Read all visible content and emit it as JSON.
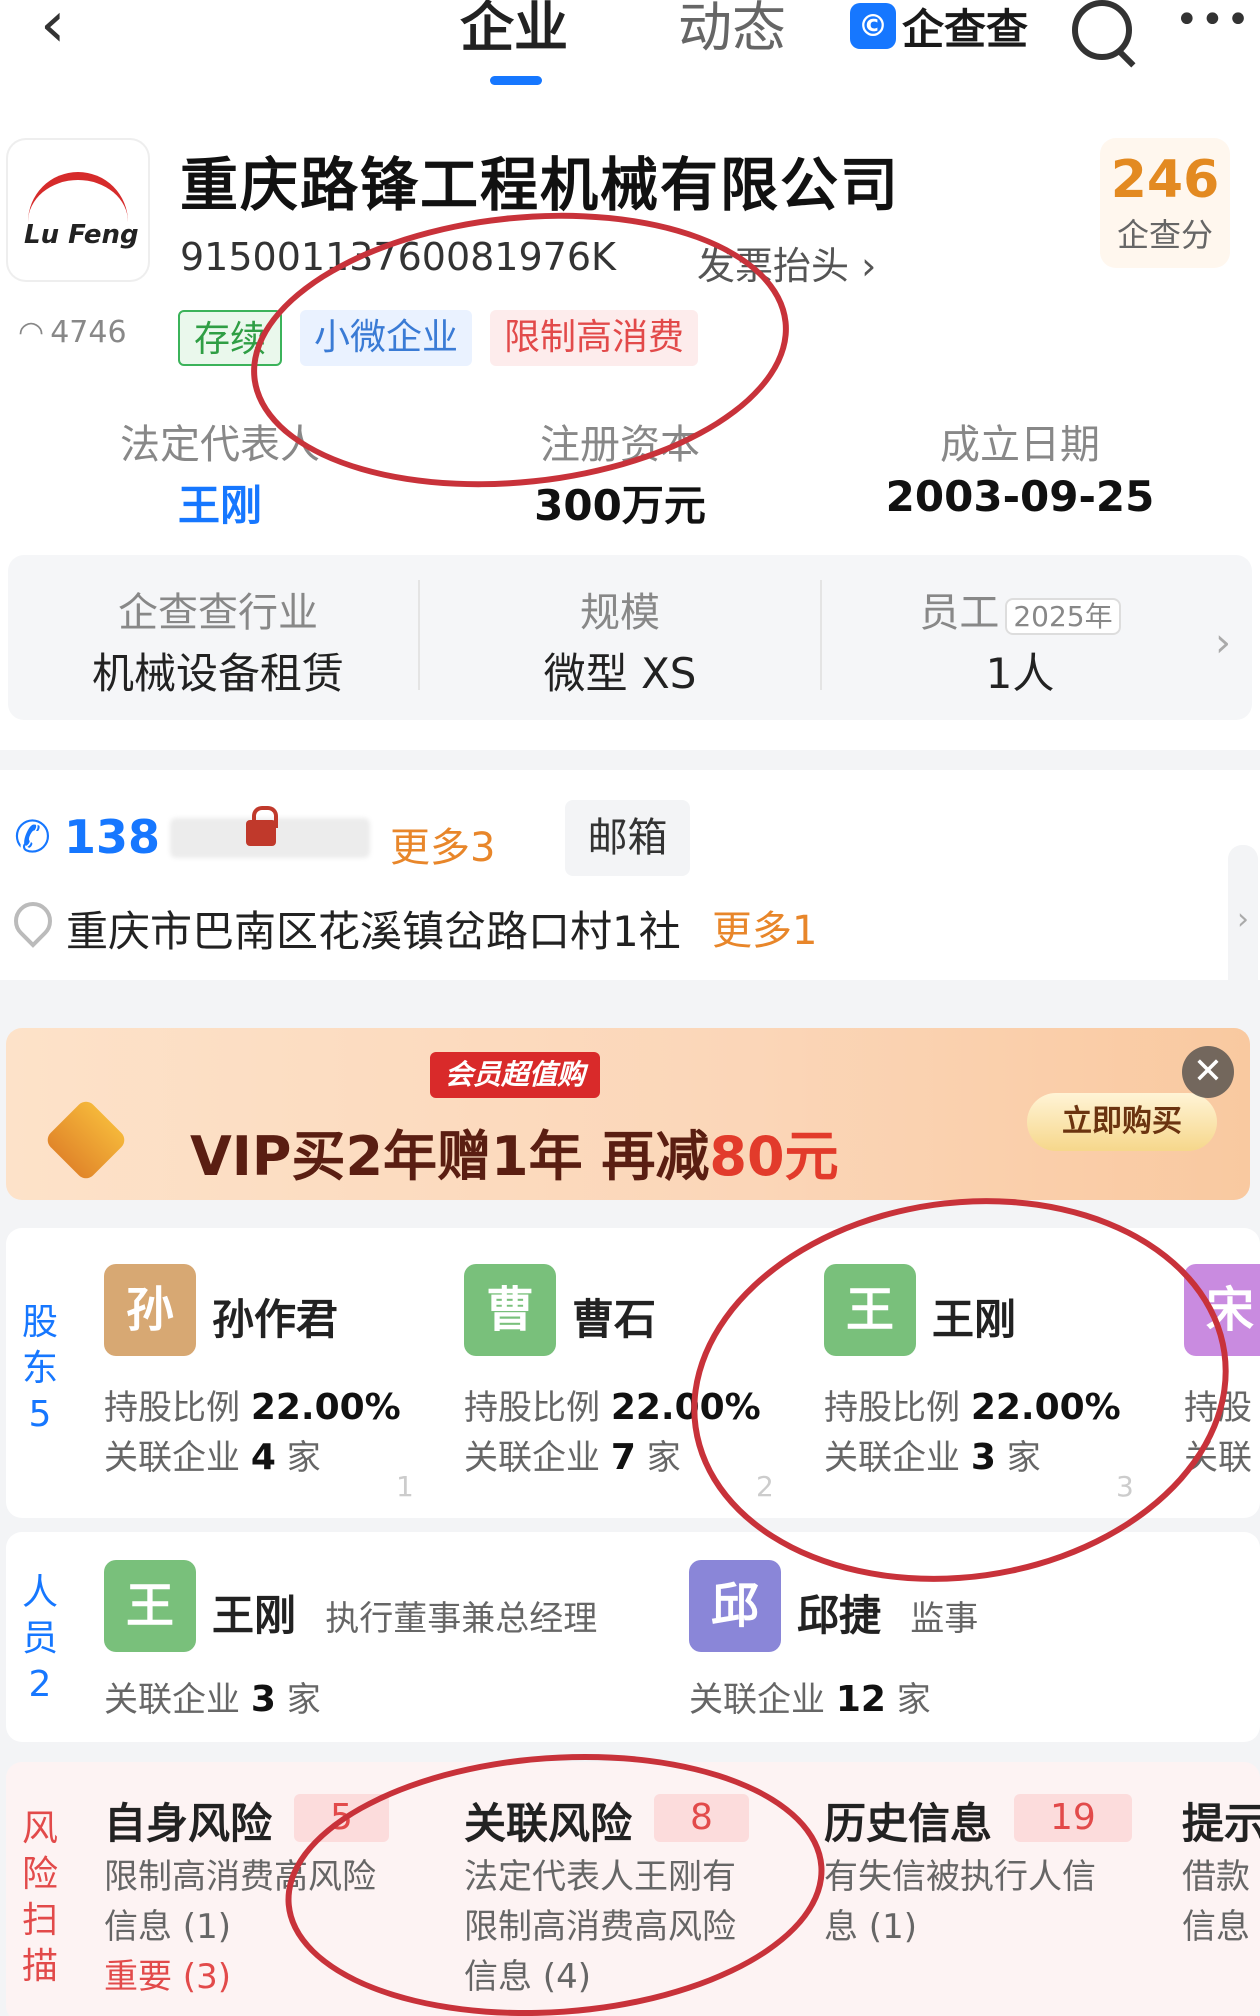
{
  "nav": {
    "tab_company": "企业",
    "tab_news": "动态",
    "brand": "企查查",
    "brand_logo": "©"
  },
  "company": {
    "logo_text": "Lu Feng",
    "name": "重庆路锋工程机械有限公司",
    "credit_code": "91500113760081976K",
    "invoice": "发票抬头 ›",
    "score": "246",
    "score_label": "企查分",
    "views": "4746",
    "tags": [
      "存续",
      "小微企业",
      "限制高消费"
    ]
  },
  "key_info": [
    {
      "label": "法定代表人",
      "value": "王刚"
    },
    {
      "label": "注册资本",
      "value": "300万元"
    },
    {
      "label": "成立日期",
      "value": "2003-09-25"
    }
  ],
  "info_grid": [
    {
      "label": "企查查行业",
      "value": "机械设备租赁"
    },
    {
      "label": "规模",
      "value": "微型 XS"
    },
    {
      "label": "员工",
      "year": "2025年",
      "value": "1人"
    }
  ],
  "contact": {
    "phone": "138",
    "more_phone": "更多3",
    "email_label": "邮箱",
    "address": "重庆市巴南区花溪镇岔路口村1社",
    "more_addr": "更多1"
  },
  "banner": {
    "badge": "会员超值购",
    "text_prefix": "VIP买2年赠1年  再减",
    "text_highlight": "80元",
    "buy": "立即购买",
    "close": "✕"
  },
  "shareholders": {
    "side_label": [
      "股",
      "东",
      "5"
    ],
    "ratio_label": "持股比例",
    "related_label": "关联企业",
    "unit": "家",
    "items": [
      {
        "avatar": "孙",
        "name": "孙作君",
        "ratio": "22.00%",
        "related": "4",
        "idx": "1",
        "color": "#d7a873"
      },
      {
        "avatar": "曹",
        "name": "曹石",
        "ratio": "22.00%",
        "related": "7",
        "idx": "2",
        "color": "#79c07b"
      },
      {
        "avatar": "王",
        "name": "王刚",
        "ratio": "22.00%",
        "related": "3",
        "idx": "3",
        "color": "#79c07b"
      },
      {
        "avatar": "宋",
        "name": "",
        "ratio": "",
        "related": "",
        "idx": "",
        "color": "#c98be0"
      }
    ],
    "partial_ratio": "持股",
    "partial_related": "关联"
  },
  "staff": {
    "side_label": [
      "人",
      "员",
      "2"
    ],
    "related_label": "关联企业",
    "unit": "家",
    "items": [
      {
        "avatar": "王",
        "name": "王刚",
        "role": "执行董事兼总经理",
        "related": "3",
        "color": "#79c07b"
      },
      {
        "avatar": "邱",
        "name": "邱捷",
        "role": "监事",
        "related": "12",
        "color": "#8a86d8"
      }
    ]
  },
  "risk": {
    "side_label": [
      "风",
      "险",
      "扫",
      "描"
    ],
    "items": [
      {
        "title": "自身风险",
        "count": "5",
        "desc1": "限制高消费高风险",
        "desc2": "信息 (1)",
        "desc3": "重要 (3)"
      },
      {
        "title": "关联风险",
        "count": "8",
        "desc1": "法定代表人王刚有",
        "desc2": "限制高消费高风险",
        "desc3": "信息 (4)"
      },
      {
        "title": "历史信息",
        "count": "19",
        "desc1": "有失信被执行人信",
        "desc2": "息 (1)",
        "desc3": ""
      },
      {
        "title": "提示",
        "count": "",
        "desc1": "借款",
        "desc2": "信息",
        "desc3": ""
      }
    ]
  },
  "colors": {
    "accent": "#1677ff",
    "danger": "#e24a4a",
    "orange": "#e8862a",
    "annotation": "#c8323a"
  }
}
